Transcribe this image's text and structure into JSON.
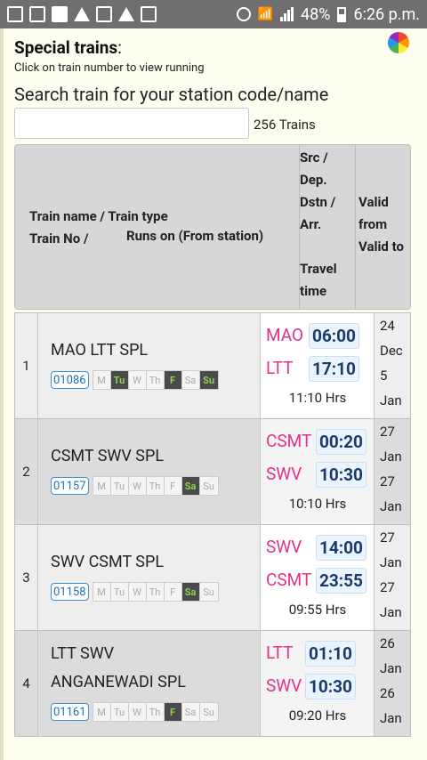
{
  "status": {
    "battery": "48%",
    "time": "6:26 p.m."
  },
  "page": {
    "title": "Special trains",
    "title_colon": ":",
    "subtitle": "Click on train number to view running",
    "search_label": "Search train for your station code/name",
    "search_value": "",
    "search_placeholder": "",
    "count": "256 Trains"
  },
  "header": {
    "name_line1": "Train name / Train type",
    "name_line2": "Train No /",
    "runs": "Runs on (From station)",
    "src_1": "Src /",
    "src_2": "Dep.",
    "src_3": "Dstn /",
    "src_4": "Arr.",
    "src_5": "Travel",
    "src_6": "time",
    "valid_1": "Valid",
    "valid_2": "from",
    "valid_3": "Valid to"
  },
  "days": [
    "M",
    "Tu",
    "W",
    "Th",
    "F",
    "Sa",
    "Su"
  ],
  "trains": [
    {
      "num": "1",
      "name_l1": "MAO LTT SPL",
      "name_l2": "",
      "train_no": "01086",
      "runs": [
        false,
        true,
        false,
        false,
        true,
        false,
        true
      ],
      "src": "MAO",
      "dep": "06:00",
      "dst": "LTT",
      "arr": "17:10",
      "duration": "11:10 Hrs",
      "valid_from_day": "24",
      "valid_from_mon": "Dec",
      "valid_to_day": "5",
      "valid_to_mon": "Jan"
    },
    {
      "num": "2",
      "name_l1": "CSMT SWV SPL",
      "name_l2": "",
      "train_no": "01157",
      "runs": [
        false,
        false,
        false,
        false,
        false,
        true,
        false
      ],
      "src": "CSMT",
      "dep": "00:20",
      "dst": "SWV",
      "arr": "10:30",
      "duration": "10:10 Hrs",
      "valid_from_day": "27",
      "valid_from_mon": "Jan",
      "valid_to_day": "27",
      "valid_to_mon": "Jan"
    },
    {
      "num": "3",
      "name_l1": "SWV CSMT SPL",
      "name_l2": "",
      "train_no": "01158",
      "runs": [
        false,
        false,
        false,
        false,
        false,
        true,
        false
      ],
      "src": "SWV",
      "dep": "14:00",
      "dst": "CSMT",
      "arr": "23:55",
      "duration": "09:55 Hrs",
      "valid_from_day": "27",
      "valid_from_mon": "Jan",
      "valid_to_day": "27",
      "valid_to_mon": "Jan"
    },
    {
      "num": "4",
      "name_l1": "LTT SWV",
      "name_l2": "ANGANEWADI SPL",
      "train_no": "01161",
      "runs": [
        false,
        false,
        false,
        false,
        true,
        false,
        false
      ],
      "src": "LTT",
      "dep": "01:10",
      "dst": "SWV",
      "arr": "10:30",
      "duration": "09:20 Hrs",
      "valid_from_day": "26",
      "valid_from_mon": "Jan",
      "valid_to_day": "26",
      "valid_to_mon": "Jan"
    }
  ]
}
